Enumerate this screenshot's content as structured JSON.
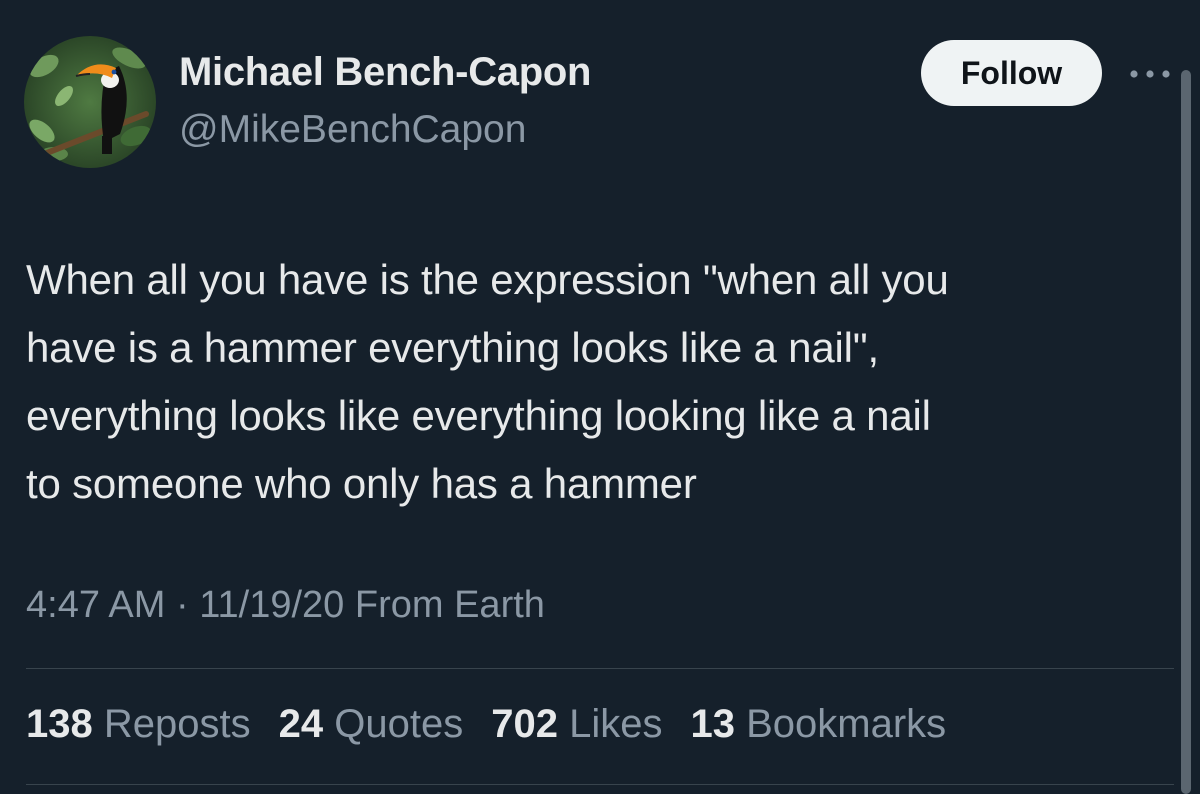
{
  "author": {
    "display_name": "Michael Bench-Capon",
    "handle": "@MikeBenchCapon",
    "avatar": "toucan-avatar"
  },
  "follow_button": {
    "label": "Follow"
  },
  "more_icon": "more-horizontal-icon",
  "tweet": {
    "lines": [
      "When all you have is the expression \"when all you",
      "have is a hammer everything looks like a nail\",",
      "everything looks like everything looking like a nail",
      "to someone who only has a hammer"
    ]
  },
  "meta": {
    "time": "4:47 AM",
    "separator": "·",
    "date": "11/19/20",
    "source": "From Earth"
  },
  "stats": [
    {
      "count": "138",
      "label": "Reposts"
    },
    {
      "count": "24",
      "label": "Quotes"
    },
    {
      "count": "702",
      "label": "Likes"
    },
    {
      "count": "13",
      "label": "Bookmarks"
    }
  ],
  "colors": {
    "background": "#15202b",
    "primary_text": "#e7e9ea",
    "secondary_text": "#8b98a5",
    "follow_button_bg": "#eff3f4"
  }
}
